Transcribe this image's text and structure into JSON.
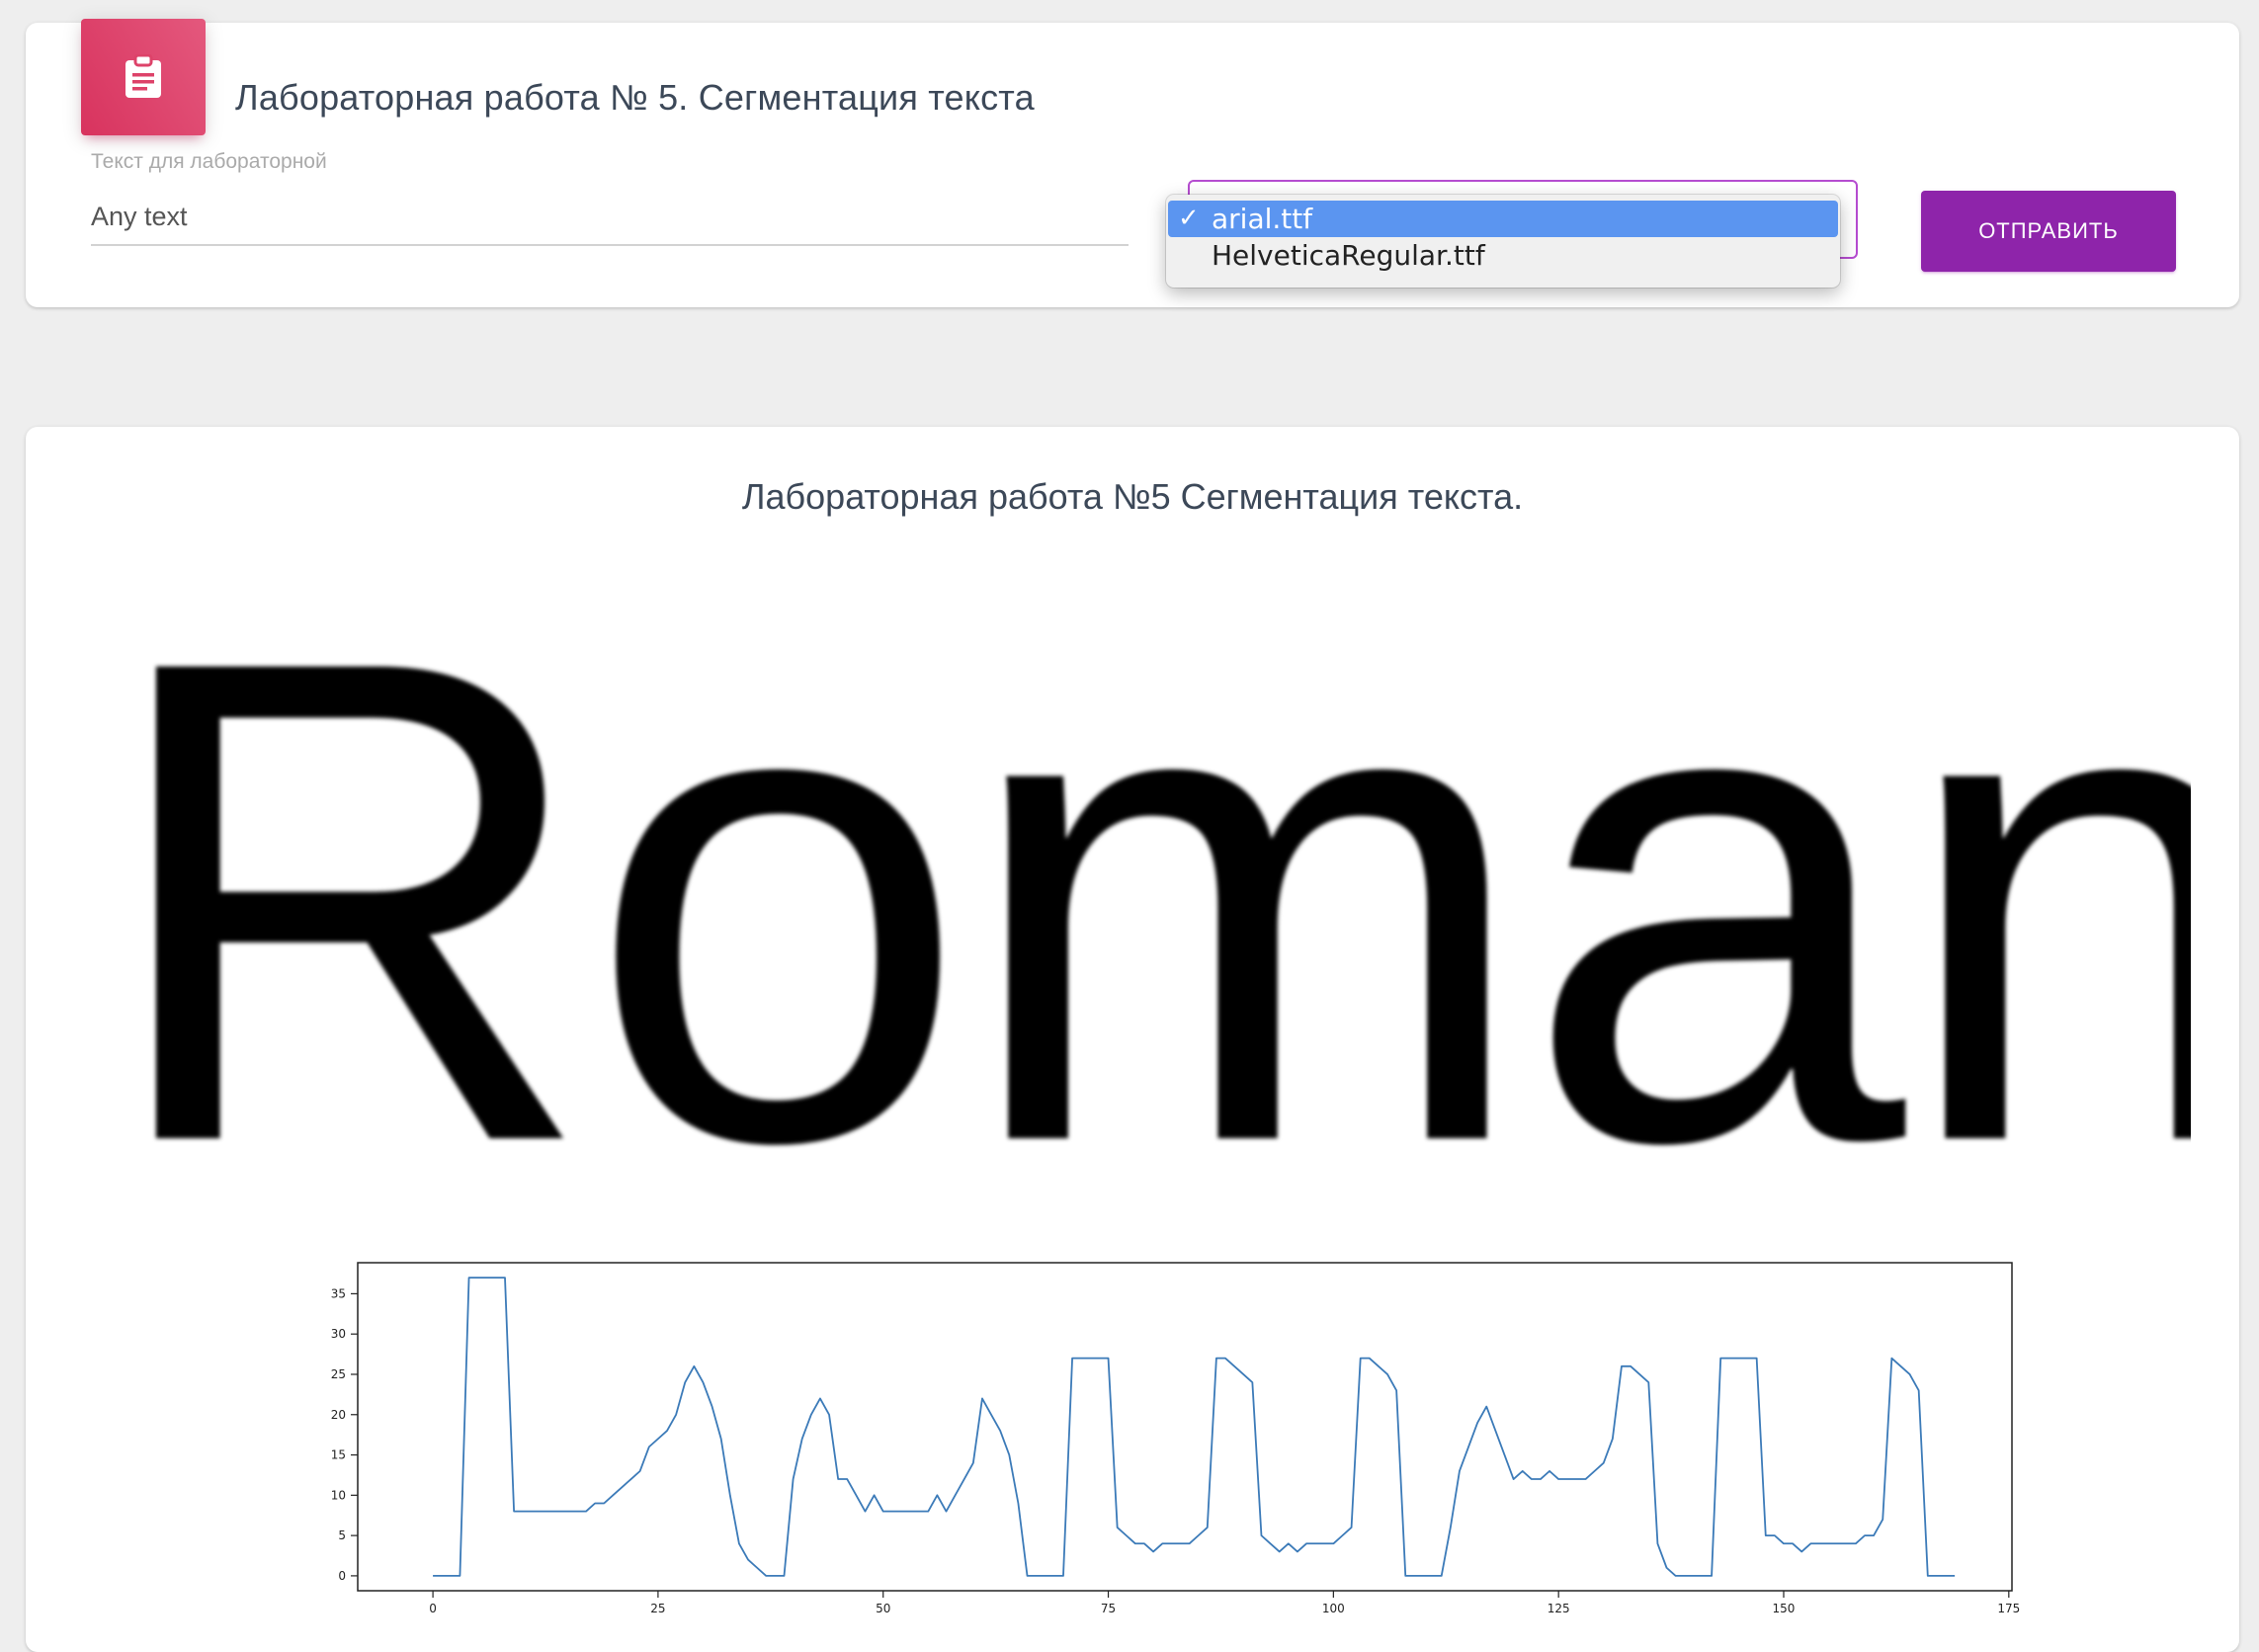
{
  "form": {
    "title": "Лабораторная работа № 5. Сегментация текста",
    "input_label": "Текст для лабораторной",
    "input_value": "Any text",
    "font_options": [
      "arial.ttf",
      "HelveticaRegular.ttf"
    ],
    "selected_font": "arial.ttf",
    "check_mark": "✓",
    "submit_label": "ОТПРАВИТЬ",
    "header_icon": "clipboard-icon"
  },
  "result": {
    "title": "Лабораторная работа №5 Сегментация текста.",
    "rendered_word": "Roman"
  },
  "colors": {
    "accent_pink": "#d8335e",
    "button_purple": "#8e24aa",
    "select_border": "#b54cd0",
    "selected_option": "#5b95f0",
    "line": "#3b7ab8"
  },
  "chart_data": {
    "type": "line",
    "title": "",
    "xlabel": "",
    "ylabel": "",
    "xlim": [
      -8.35,
      175.35
    ],
    "ylim": [
      -1.85,
      38.85
    ],
    "xticks": [
      0,
      25,
      50,
      75,
      100,
      125,
      150,
      175
    ],
    "yticks": [
      0,
      5,
      10,
      15,
      20,
      25,
      30,
      35
    ],
    "grid": false,
    "series": [
      {
        "values": [
          0,
          0,
          0,
          0,
          37,
          37,
          37,
          37,
          37,
          8,
          8,
          8,
          8,
          8,
          8,
          8,
          8,
          8,
          9,
          9,
          10,
          11,
          12,
          13,
          16,
          17,
          18,
          20,
          24,
          26,
          24,
          21,
          17,
          10,
          4,
          2,
          1,
          0,
          0,
          0,
          12,
          17,
          20,
          22,
          20,
          12,
          12,
          10,
          8,
          10,
          8,
          8,
          8,
          8,
          8,
          8,
          10,
          8,
          10,
          12,
          14,
          22,
          20,
          18,
          15,
          9,
          0,
          0,
          0,
          0,
          0,
          27,
          27,
          27,
          27,
          27,
          6,
          5,
          4,
          4,
          3,
          4,
          4,
          4,
          4,
          5,
          6,
          27,
          27,
          26,
          25,
          24,
          5,
          4,
          3,
          4,
          3,
          4,
          4,
          4,
          4,
          5,
          6,
          27,
          27,
          26,
          25,
          23,
          0,
          0,
          0,
          0,
          0,
          6,
          13,
          16,
          19,
          21,
          18,
          15,
          12,
          13,
          12,
          12,
          13,
          12,
          12,
          12,
          12,
          13,
          14,
          17,
          26,
          26,
          25,
          24,
          4,
          1,
          0,
          0,
          0,
          0,
          0,
          27,
          27,
          27,
          27,
          27,
          5,
          5,
          4,
          4,
          3,
          4,
          4,
          4,
          4,
          4,
          4,
          5,
          5,
          7,
          27,
          26,
          25,
          23,
          0,
          0,
          0,
          0
        ]
      }
    ]
  }
}
